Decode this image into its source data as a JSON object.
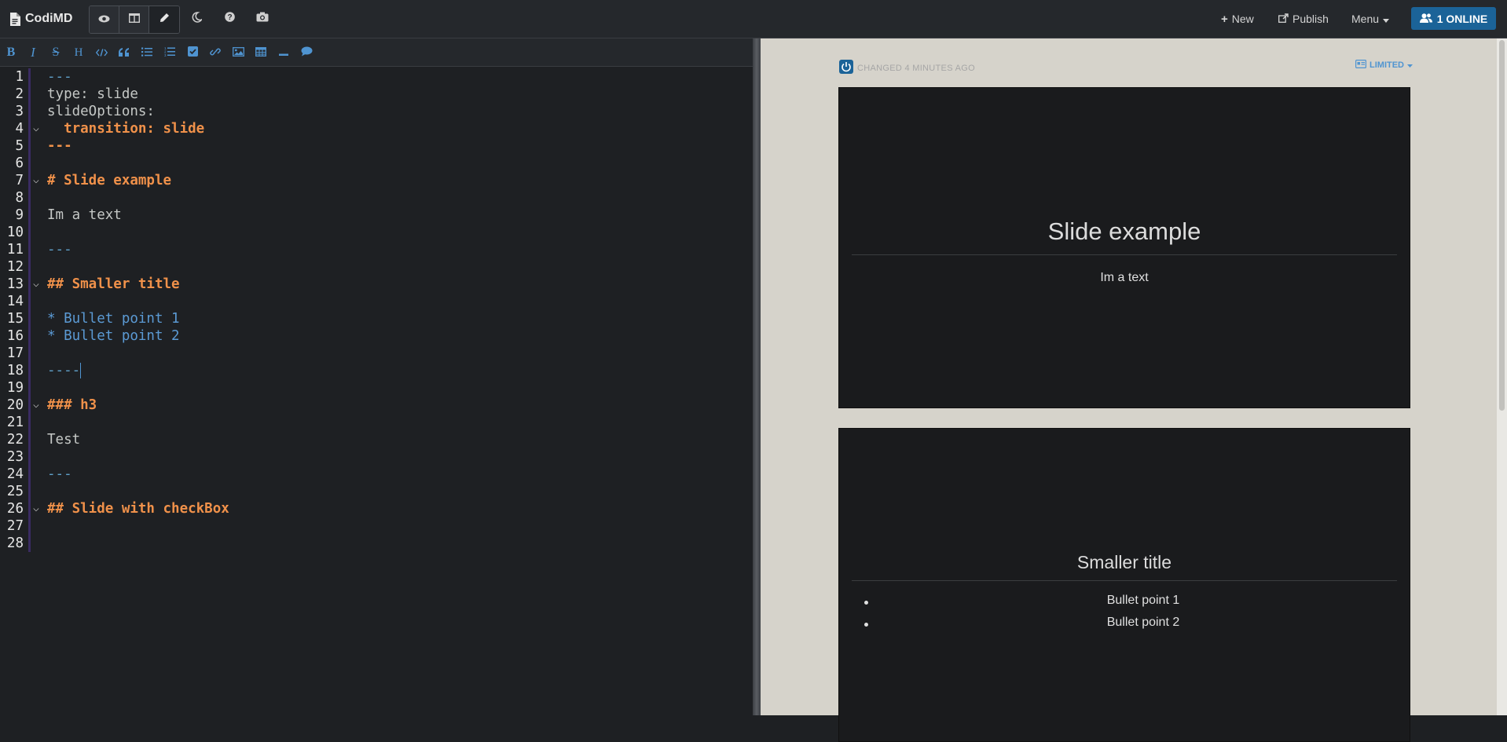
{
  "navbar": {
    "brand": "CodiMD",
    "mode_buttons": [
      "view-mode",
      "both-mode",
      "edit-mode"
    ],
    "new_label": "New",
    "publish_label": "Publish",
    "menu_label": "Menu",
    "online_label": "1 ONLINE"
  },
  "toolbar": {
    "items": [
      "bold",
      "italic",
      "strikethrough",
      "heading",
      "code",
      "quote",
      "unordered-list",
      "ordered-list",
      "checklist",
      "link",
      "image",
      "table",
      "horizontal-rule",
      "comment"
    ]
  },
  "editor": {
    "lines": [
      {
        "n": "1",
        "text": "---",
        "cls": "c-meta"
      },
      {
        "n": "2",
        "text": "type: slide",
        "cls": "c-plain"
      },
      {
        "n": "3",
        "text": "slideOptions:",
        "cls": "c-plain"
      },
      {
        "n": "4",
        "text": "  transition: slide",
        "cls": "c-head",
        "fold": true
      },
      {
        "n": "5",
        "text": "---",
        "cls": "c-head"
      },
      {
        "n": "6",
        "text": "",
        "cls": "c-plain"
      },
      {
        "n": "7",
        "text": "# Slide example",
        "cls": "c-head",
        "fold": true
      },
      {
        "n": "8",
        "text": "",
        "cls": "c-plain"
      },
      {
        "n": "9",
        "text": "Im a text",
        "cls": "c-plain"
      },
      {
        "n": "10",
        "text": "",
        "cls": "c-plain"
      },
      {
        "n": "11",
        "text": "---",
        "cls": "c-meta"
      },
      {
        "n": "12",
        "text": "",
        "cls": "c-plain"
      },
      {
        "n": "13",
        "text": "## Smaller title",
        "cls": "c-head",
        "fold": true
      },
      {
        "n": "14",
        "text": "",
        "cls": "c-plain"
      },
      {
        "n": "15",
        "text": "* Bullet point 1",
        "cls": "c-list"
      },
      {
        "n": "16",
        "text": "* Bullet point 2",
        "cls": "c-list"
      },
      {
        "n": "17",
        "text": "",
        "cls": "c-plain"
      },
      {
        "n": "18",
        "text": "----",
        "cls": "c-meta",
        "cursor": true
      },
      {
        "n": "19",
        "text": "",
        "cls": "c-plain"
      },
      {
        "n": "20",
        "text": "### h3",
        "cls": "c-head",
        "fold": true
      },
      {
        "n": "21",
        "text": "",
        "cls": "c-plain"
      },
      {
        "n": "22",
        "text": "Test",
        "cls": "c-plain"
      },
      {
        "n": "23",
        "text": "",
        "cls": "c-plain"
      },
      {
        "n": "24",
        "text": "---",
        "cls": "c-meta"
      },
      {
        "n": "25",
        "text": "",
        "cls": "c-plain"
      },
      {
        "n": "26",
        "text": "## Slide with checkBox",
        "cls": "c-head",
        "fold": true
      },
      {
        "n": "27",
        "text": "",
        "cls": "c-plain"
      },
      {
        "n": "28",
        "text": "",
        "cls": "c-plain"
      }
    ]
  },
  "preview": {
    "changed_label": "CHANGED 4 MINUTES AGO",
    "permission_label": "LIMITED",
    "slide1": {
      "title": "Slide example",
      "text": "Im a text"
    },
    "slide2": {
      "title": "Smaller title",
      "bullets": [
        "Bullet point 1",
        "Bullet point 2"
      ]
    }
  },
  "colors": {
    "accent": "#4f94d1",
    "online_badge": "#1b6398",
    "heading_code": "#f0914a",
    "preview_bg": "#d6d3cb"
  }
}
